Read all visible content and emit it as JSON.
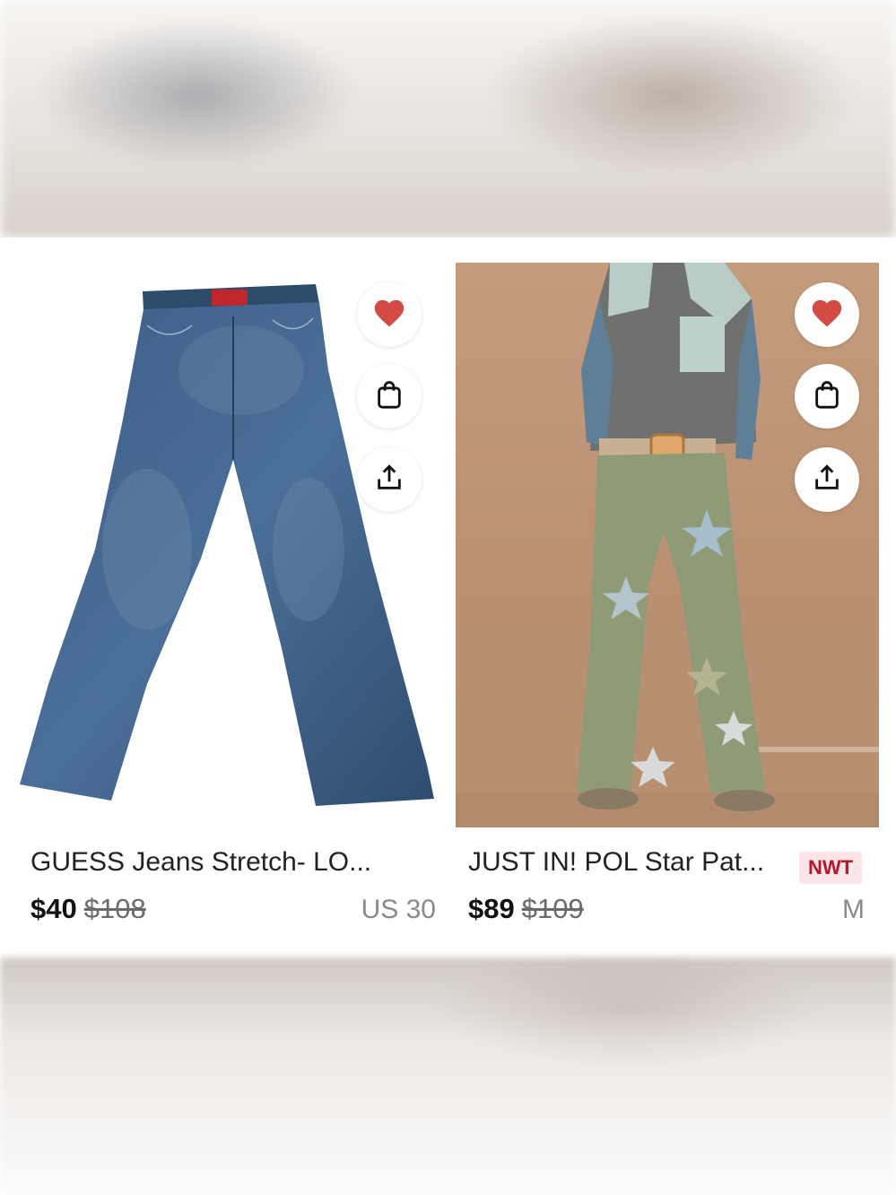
{
  "listings": [
    {
      "title": "GUESS Jeans Stretch- LO...",
      "price": "$40",
      "original_price": "$108",
      "size": "US 30",
      "badge": "",
      "image": "blue-flare-jeans",
      "like_color": "#d24b44"
    },
    {
      "title": "JUST IN! POL Star Pat...",
      "price": "$89",
      "original_price": "$109",
      "size": "M",
      "badge": "NWT",
      "image": "model-olive-star-patch-pants",
      "like_color": "#d24b44"
    }
  ],
  "icons": {
    "like": "heart-icon",
    "bag": "shopping-bag-icon",
    "share": "share-icon"
  }
}
